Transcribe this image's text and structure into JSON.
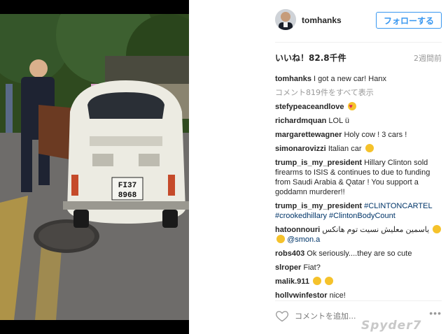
{
  "header": {
    "username": "tomhanks",
    "follow_label": "フォローする"
  },
  "stats": {
    "likes": "いいね！82.8千件",
    "time_ago": "2週間前"
  },
  "view_all_comments": "コメント819件をすべて表示",
  "caption": {
    "user": "tomhanks",
    "text": "I got a new car! Hanx"
  },
  "comments": [
    {
      "user": "stefypeaceandlove",
      "text": "",
      "emoji": "heart-eyes"
    },
    {
      "user": "richardmquan",
      "text": "LOL ü"
    },
    {
      "user": "margarettewagner",
      "text": "Holy cow ! 3 cars !"
    },
    {
      "user": "simonarovizzi",
      "text": "Italian car",
      "emoji": "sunglasses"
    },
    {
      "user": "trump_is_my_president",
      "text": "Hillary Clinton sold firearms to ISIS & continues to due to funding from Saudi Arabia & Qatar ! You support a goddamn murderer!!"
    },
    {
      "user": "trump_is_my_president",
      "text": "#CLINTONCARTEL #crookedhillary #ClintonBodyCount"
    },
    {
      "user": "hatoonnouri",
      "text": "ياسمين معليش نسيت توم هانكس",
      "mention": "@smon.a"
    },
    {
      "user": "robs403",
      "text": "Ok seriously....they are so cute"
    },
    {
      "user": "slroper",
      "text": "Fiat?"
    },
    {
      "user": "malik.911",
      "text": "",
      "emoji": "laughing"
    },
    {
      "user": "hollywinfestor",
      "text": "nice!"
    }
  ],
  "input": {
    "placeholder": "コメントを追加..."
  },
  "photo": {
    "plate_line1": "FI37",
    "plate_line2": "8968"
  },
  "watermark": "Spyder7",
  "icons": {
    "like": "heart-outline-icon",
    "more": "ellipsis-icon"
  },
  "colors": {
    "accent": "#3897f0",
    "hashtag": "#003569",
    "muted": "#999999"
  }
}
